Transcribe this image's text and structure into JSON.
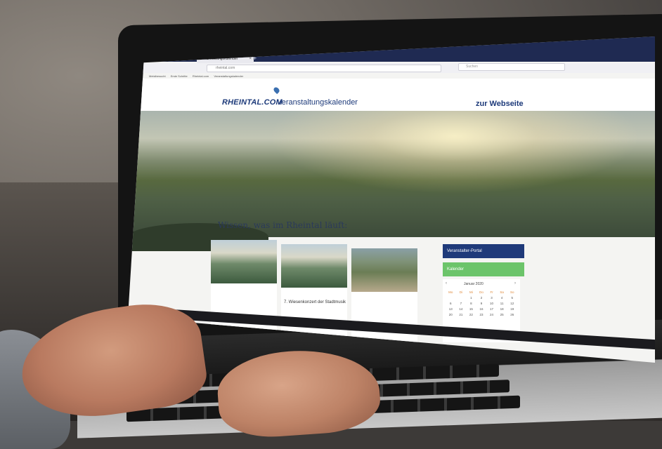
{
  "browser": {
    "tab_title": "Veranstaltungskalender",
    "url": "rheintal.com",
    "search_placeholder": "Suchen",
    "bookmarks": [
      "Meistbesucht",
      "Erste Schritte",
      "Rheintal.com",
      "Veranstaltungskalender"
    ]
  },
  "site": {
    "logo": "RHEINTAL.COM",
    "logo_subtitle": "Veranstaltungskalender",
    "website_link": "zur Webseite"
  },
  "main": {
    "heading": "Wissen, was im Rheintal läuft:",
    "subheading": ""
  },
  "events": [
    {
      "meta": "",
      "title": ""
    },
    {
      "meta": "",
      "title": "7. Wiesenkonzert der Stadtmusik"
    },
    {
      "meta": "",
      "title": ""
    }
  ],
  "sidebar": {
    "portal_button": "Veranstalter-Portal",
    "green_button": "Kalender",
    "calendar_month": "Januar 2020",
    "weekday_headers": [
      "Mo",
      "Di",
      "Mi",
      "Do",
      "Fr",
      "Sa",
      "So"
    ],
    "days": [
      "",
      "",
      "1",
      "2",
      "3",
      "4",
      "5",
      "6",
      "7",
      "8",
      "9",
      "10",
      "11",
      "12",
      "13",
      "14",
      "15",
      "16",
      "17",
      "18",
      "19",
      "20",
      "21",
      "22",
      "23",
      "24",
      "25",
      "26"
    ]
  },
  "colors": {
    "brand_blue": "#1d3a7a",
    "portal_button": "#1f3a7a",
    "green_button": "#6cc46a",
    "titlebar": "#1f2a52"
  }
}
